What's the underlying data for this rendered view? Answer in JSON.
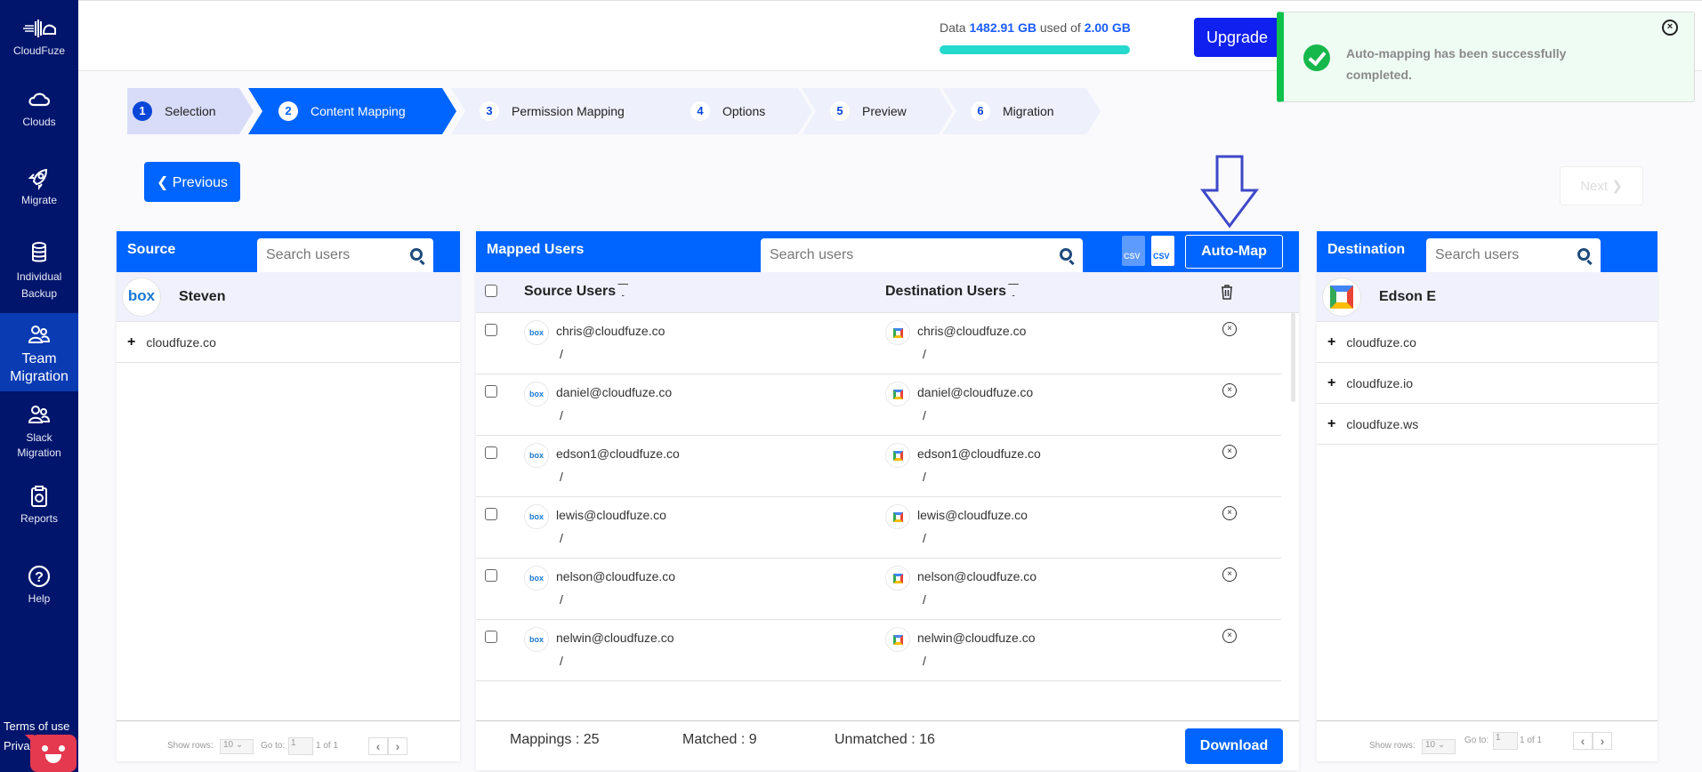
{
  "sidebar": {
    "brand": "CloudFuze",
    "items": [
      {
        "label": "Clouds",
        "icon": "cloud-icon"
      },
      {
        "label": "Migrate",
        "icon": "rocket-icon"
      },
      {
        "label": "Individual Backup",
        "icon": "database-icon"
      },
      {
        "label": "Team Migration",
        "icon": "users-icon",
        "active": true
      },
      {
        "label": "Slack Migration",
        "icon": "users-icon"
      },
      {
        "label": "Reports",
        "icon": "clipboard-icon"
      },
      {
        "label": "Help",
        "icon": "help-circle-icon"
      }
    ],
    "footer": {
      "terms": "Terms of use",
      "privacy": "Privacy policy"
    }
  },
  "topbar": {
    "usage_prefix": "Data",
    "usage_used": "1482.91 GB",
    "usage_mid": "used of",
    "usage_total": "2.00 GB",
    "usage_fraction": 1.0,
    "upgrade_label": "Upgrade"
  },
  "toast": {
    "message": "Auto-mapping has been successfully completed.",
    "status": "success",
    "close_symbol": "×"
  },
  "stepper": {
    "steps": [
      {
        "num": "1",
        "label": "Selection"
      },
      {
        "num": "2",
        "label": "Content Mapping"
      },
      {
        "num": "3",
        "label": "Permission Mapping"
      },
      {
        "num": "4",
        "label": "Options"
      },
      {
        "num": "5",
        "label": "Preview"
      },
      {
        "num": "6",
        "label": "Migration"
      }
    ],
    "active_index": 1
  },
  "nav": {
    "previous": "❮ Previous",
    "next": "Next ❯"
  },
  "source": {
    "title": "Source",
    "search_placeholder": "Search users",
    "cloud_logo": "box",
    "owner": "Steven",
    "domains": [
      "cloudfuze.co"
    ],
    "pager": {
      "show_rows_label": "Show rows:",
      "rows": "10",
      "goto_label": "Go to:",
      "page": "1",
      "page_info": "1 of 1"
    }
  },
  "mapped": {
    "title": "Mapped Users",
    "search_placeholder": "Search users",
    "csv_download": "CSV",
    "csv_upload": "CSV",
    "automap_label": "Auto-Map",
    "col_source": "Source Users",
    "col_destination": "Destination Users",
    "rows": [
      {
        "source": "chris@cloudfuze.co",
        "source_path": "/",
        "dest": "chris@cloudfuze.co",
        "dest_path": "/"
      },
      {
        "source": "daniel@cloudfuze.co",
        "source_path": "/",
        "dest": "daniel@cloudfuze.co",
        "dest_path": "/"
      },
      {
        "source": "edson1@cloudfuze.co",
        "source_path": "/",
        "dest": "edson1@cloudfuze.co",
        "dest_path": "/"
      },
      {
        "source": "lewis@cloudfuze.co",
        "source_path": "/",
        "dest": "lewis@cloudfuze.co",
        "dest_path": "/"
      },
      {
        "source": "nelson@cloudfuze.co",
        "source_path": "/",
        "dest": "nelson@cloudfuze.co",
        "dest_path": "/"
      },
      {
        "source": "nelwin@cloudfuze.co",
        "source_path": "/",
        "dest": "nelwin@cloudfuze.co",
        "dest_path": "/"
      }
    ],
    "footer": {
      "mappings": "Mappings : 25",
      "matched": "Matched : 9",
      "unmatched": "Unmatched : 16",
      "download_label": "Download"
    }
  },
  "destination": {
    "title": "Destination",
    "search_placeholder": "Search users",
    "cloud_logo": "google-workspace",
    "owner": "Edson E",
    "domains": [
      "cloudfuze.co",
      "cloudfuze.io",
      "cloudfuze.ws"
    ],
    "pager": {
      "show_rows_label": "Show rows:",
      "rows": "10",
      "goto_label": "Go to:",
      "page": "1",
      "page_info": "1 of 1"
    }
  },
  "colors": {
    "sidebar": "#01156c",
    "primary": "#0065ff",
    "success": "#0ec24c",
    "usage_bar": "#26d9cd",
    "upgrade": "#1020ee"
  }
}
